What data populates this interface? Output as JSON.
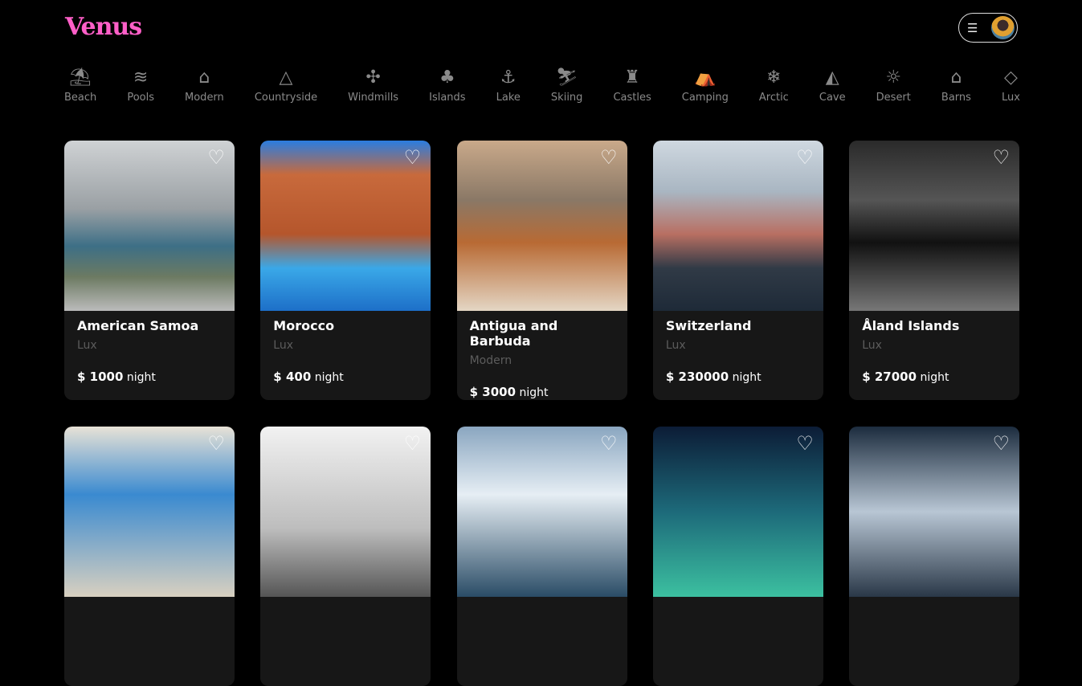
{
  "header": {
    "logo": "Venus",
    "menu_icon": "hamburger-icon",
    "avatar": "user-avatar"
  },
  "categories": [
    {
      "label": "Beach",
      "icon": "⛱"
    },
    {
      "label": "Pools",
      "icon": "≋"
    },
    {
      "label": "Modern",
      "icon": "⌂"
    },
    {
      "label": "Countryside",
      "icon": "△"
    },
    {
      "label": "Windmills",
      "icon": "✣"
    },
    {
      "label": "Islands",
      "icon": "♣"
    },
    {
      "label": "Lake",
      "icon": "⚓"
    },
    {
      "label": "Skiing",
      "icon": "⛷"
    },
    {
      "label": "Castles",
      "icon": "♜"
    },
    {
      "label": "Camping",
      "icon": "⛺"
    },
    {
      "label": "Arctic",
      "icon": "❄"
    },
    {
      "label": "Cave",
      "icon": "◭"
    },
    {
      "label": "Desert",
      "icon": "☼"
    },
    {
      "label": "Barns",
      "icon": "⌂"
    },
    {
      "label": "Lux",
      "icon": "◇"
    }
  ],
  "listings": [
    {
      "title": "American Samoa",
      "type": "Lux",
      "price": "$ 1000",
      "unit": "night",
      "bg": "linear-gradient(180deg,#cfd2d4 0%,#9aa0a4 40%,#3d6f86 62%,#6c7a62 80%,#bbb 100%)"
    },
    {
      "title": "Morocco",
      "type": "Lux",
      "price": "$ 400",
      "unit": "night",
      "bg": "linear-gradient(180deg,#2a7de0 0%,#c86a3c 20%,#b5562c 55%,#3aa8e8 75%,#1d6fc8 100%)"
    },
    {
      "title": "Antigua and Barbuda",
      "type": "Modern",
      "price": "$ 3000",
      "unit": "night",
      "bg": "linear-gradient(180deg,#c9a98a 0%,#8a7866 35%,#b86a34 60%,#e4d6c4 100%)"
    },
    {
      "title": "Switzerland",
      "type": "Lux",
      "price": "$ 230000",
      "unit": "night",
      "bg": "linear-gradient(180deg,#cfd8e0 0%,#a9b6c2 30%,#b86f62 55%,#303a46 75%,#1e2a38 100%)"
    },
    {
      "title": "Åland Islands",
      "type": "Lux",
      "price": "$ 27000",
      "unit": "night",
      "bg": "linear-gradient(180deg,#2a2a2a 0%,#555 35%,#111 60%,#777 100%)"
    },
    {
      "title": "",
      "type": "",
      "price": "",
      "unit": "",
      "bg": "linear-gradient(180deg,#e8e2d6 0%,#3a8ad0 40%,#d8d0c0 100%)"
    },
    {
      "title": "",
      "type": "",
      "price": "",
      "unit": "",
      "bg": "linear-gradient(180deg,#f2f2f2 0%,#bdbdbd 60%,#555 100%)"
    },
    {
      "title": "",
      "type": "",
      "price": "",
      "unit": "",
      "bg": "linear-gradient(180deg,#8aa6c0 0%,#e6eef4 40%,#2a4c66 100%)"
    },
    {
      "title": "",
      "type": "",
      "price": "",
      "unit": "",
      "bg": "linear-gradient(180deg,#0c1c36 0%,#1d6a7a 50%,#3cc0a0 100%)"
    },
    {
      "title": "",
      "type": "",
      "price": "",
      "unit": "",
      "bg": "linear-gradient(180deg,#1c2c3e 0%,#b8c6d4 50%,#2a3848 100%)"
    }
  ]
}
